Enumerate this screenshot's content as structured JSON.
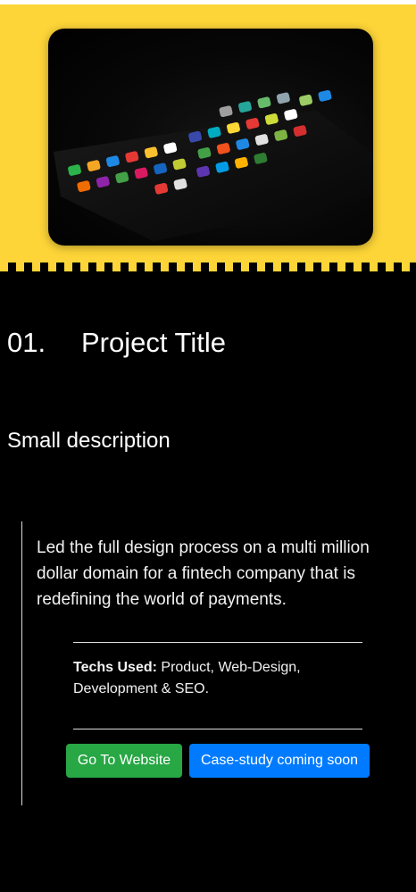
{
  "hero": {
    "image_icon": "smartphone-home-screen-photo",
    "background_color": "#fdd538"
  },
  "project": {
    "number": "01.",
    "title": "Project Title",
    "small_description": "Small description",
    "details": "Led the full design process on a multi million dollar domain for a fintech company that is redefining the world of payments.",
    "techs_label": "Techs Used:",
    "techs_value": "Product, Web-Design, Development & SEO."
  },
  "buttons": {
    "website": "Go To Website",
    "case_study": "Case-study coming soon",
    "website_color": "#28a745",
    "case_study_color": "#007bff"
  }
}
